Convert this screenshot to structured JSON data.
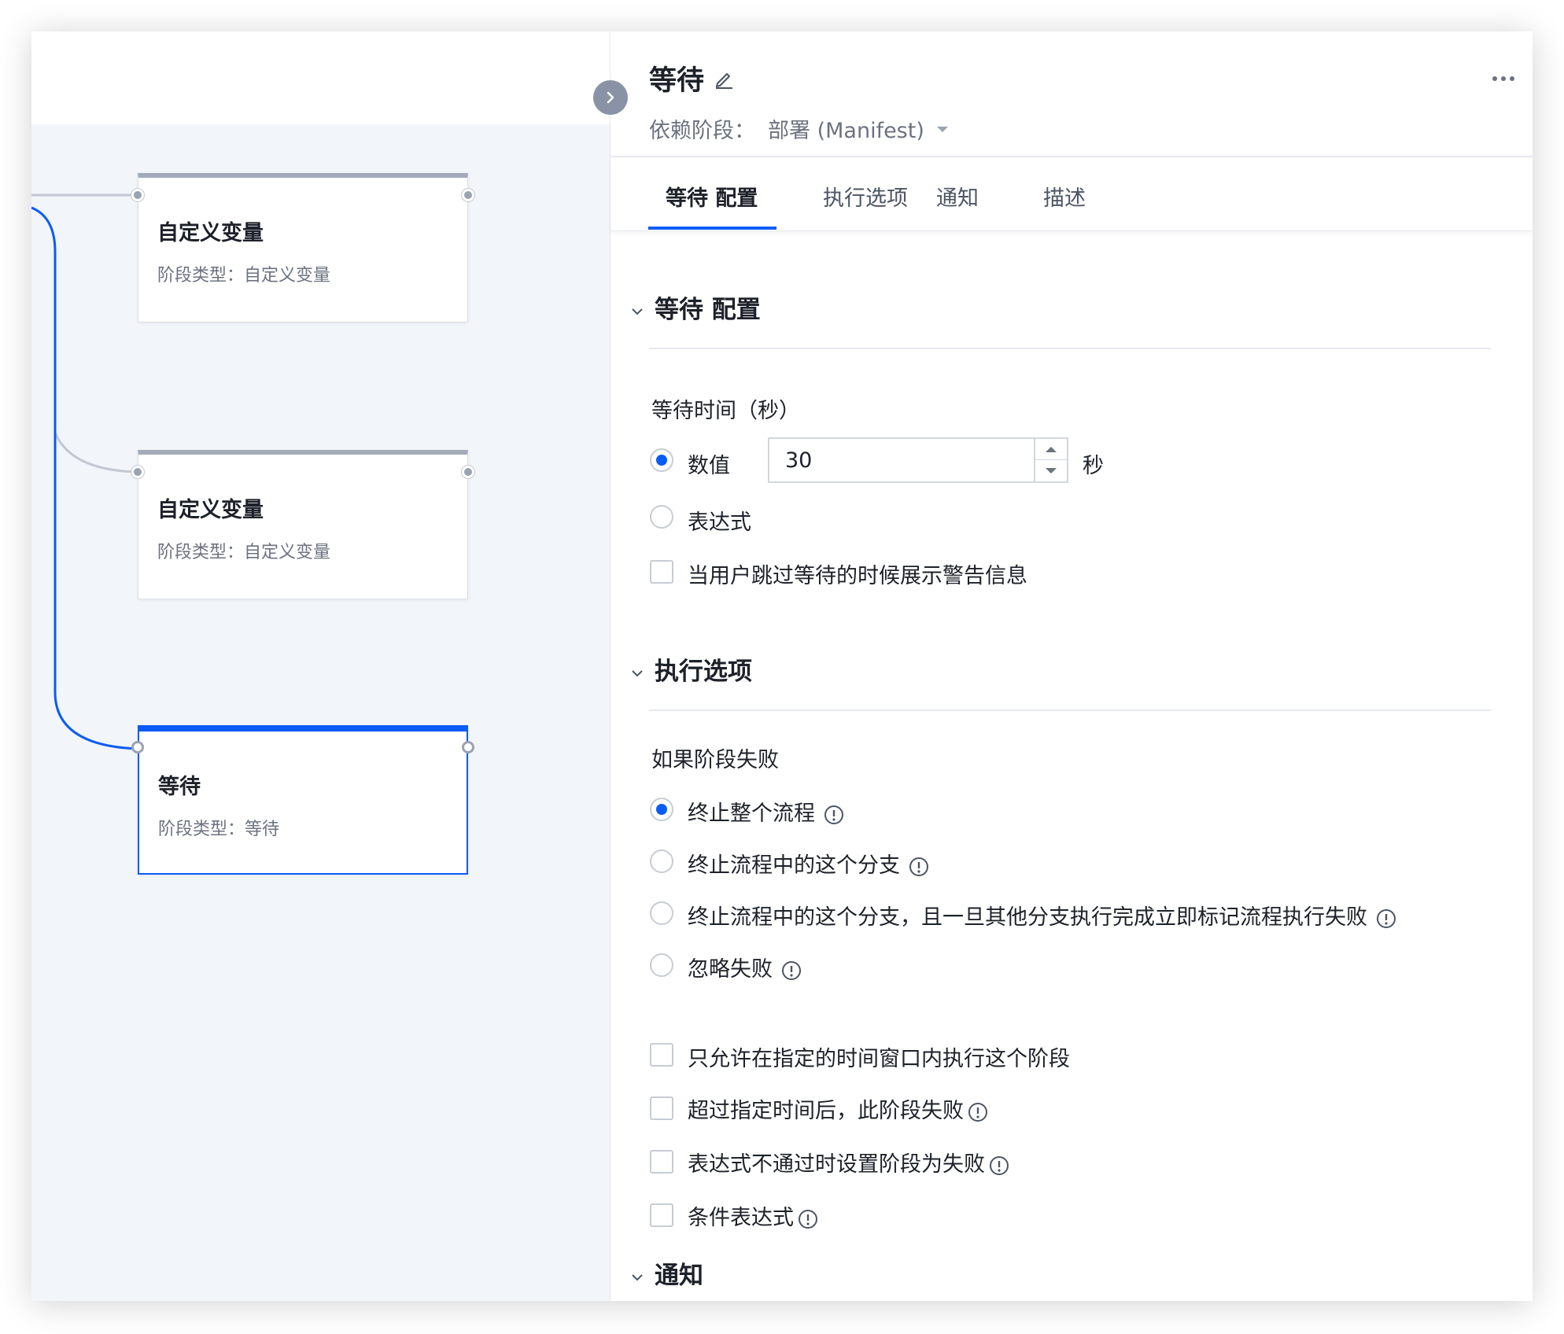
{
  "canvas": {
    "nodes": [
      {
        "title": "自定义变量",
        "type_label": "阶段类型：",
        "type_value": "自定义变量"
      },
      {
        "title": "自定义变量",
        "type_label": "阶段类型：",
        "type_value": "自定义变量"
      },
      {
        "title": "等待",
        "type_label": "阶段类型：",
        "type_value": "等待"
      }
    ]
  },
  "panel": {
    "title": "等待",
    "dependency_label": "依赖阶段：",
    "dependency_value": "部署 (Manifest)",
    "tabs": [
      "等待 配置",
      "执行选项",
      "通知",
      "描述"
    ],
    "active_tab": 0
  },
  "wait_config": {
    "heading": "等待 配置",
    "time_label": "等待时间（秒）",
    "option_number": "数值",
    "number_value": "30",
    "unit": "秒",
    "option_expression": "表达式",
    "warn_checkbox": "当用户跳过等待的时候展示警告信息"
  },
  "exec_options": {
    "heading": "执行选项",
    "fail_label": "如果阶段失败",
    "fail_options": [
      "终止整个流程",
      "终止流程中的这个分支",
      "终止流程中的这个分支，且一旦其他分支执行完成立即标记流程执行失败",
      "忽略失败"
    ],
    "selected_fail_option": 0,
    "checkboxes": [
      "只允许在指定的时间窗口内执行这个阶段",
      "超过指定时间后，此阶段失败",
      "表达式不通过时设置阶段为失败",
      "条件表达式"
    ]
  },
  "notify": {
    "heading": "通知"
  },
  "colors": {
    "accent": "#0a5cf5",
    "canvas_bg": "#f2f5fa"
  }
}
